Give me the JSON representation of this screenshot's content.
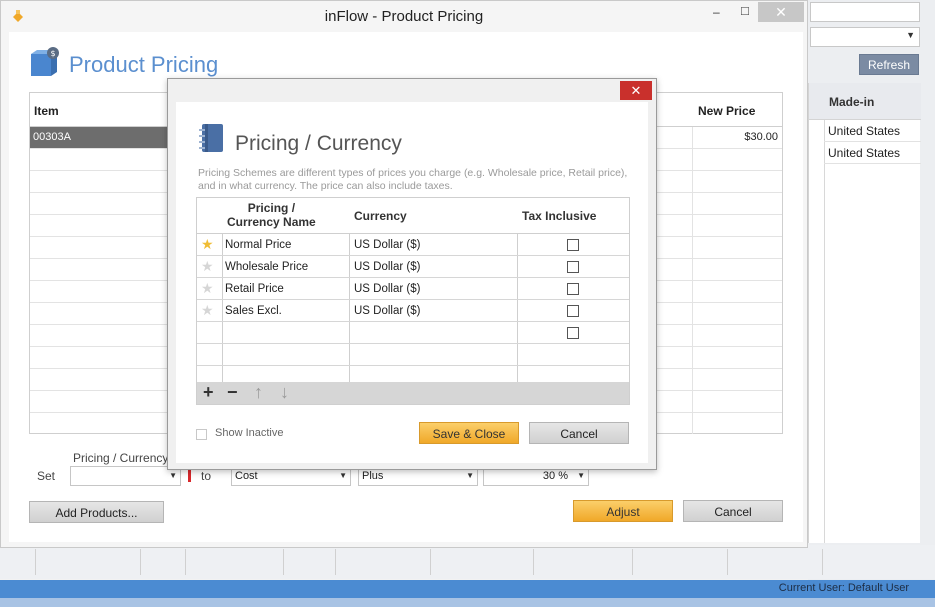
{
  "window": {
    "title": "inFlow - Product Pricing",
    "min_glyph": "–",
    "max_glyph": "□",
    "close_glyph": "✕"
  },
  "background_app": {
    "refresh_label": "Refresh",
    "column_header": "Made-in",
    "rows": [
      "United States",
      "United States"
    ]
  },
  "page": {
    "title": "Product Pricing",
    "grid": {
      "columns": [
        "Item",
        "New Price"
      ],
      "rows": [
        {
          "item": "00303A",
          "new_price": "$30.00"
        }
      ]
    },
    "bottom": {
      "pricing_currency_label": "Pricing / Currency",
      "set_label": "Set",
      "pricing_value": "",
      "to_label": "to",
      "base_value": "Cost",
      "operator_value": "Plus",
      "amount_value": "30 %",
      "add_products_label": "Add Products...",
      "adjust_label": "Adjust",
      "cancel_label": "Cancel"
    }
  },
  "dialog": {
    "close_glyph": "✕",
    "title": "Pricing / Currency",
    "description": "Pricing Schemes are different types of prices you charge (e.g. Wholesale price, Retail price), and in what currency. The price can also include taxes.",
    "columns": {
      "name_line1": "Pricing /",
      "name_line2": "Currency Name",
      "currency": "Currency",
      "tax": "Tax Inclusive"
    },
    "rows": [
      {
        "name": "Normal Price",
        "currency": "US Dollar  ($)",
        "tax_inclusive": false,
        "default": true
      },
      {
        "name": "Wholesale Price",
        "currency": "US Dollar  ($)",
        "tax_inclusive": false,
        "default": false
      },
      {
        "name": "Retail Price",
        "currency": "US Dollar  ($)",
        "tax_inclusive": false,
        "default": false
      },
      {
        "name": "Sales Excl.",
        "currency": "US Dollar  ($)",
        "tax_inclusive": false,
        "default": false
      }
    ],
    "toolbar": {
      "add": "+",
      "remove": "−",
      "up": "↑",
      "down": "↓"
    },
    "show_inactive_label": "Show Inactive",
    "save_close_label": "Save & Close",
    "cancel_label": "Cancel"
  },
  "status_bar": {
    "user_text": "Current User:  Default User"
  },
  "colors": {
    "accent_blue": "#5b8fcf",
    "gold_button": "#f0a829",
    "dialog_close": "#c9302c",
    "status_blue": "#4b8bd2"
  }
}
